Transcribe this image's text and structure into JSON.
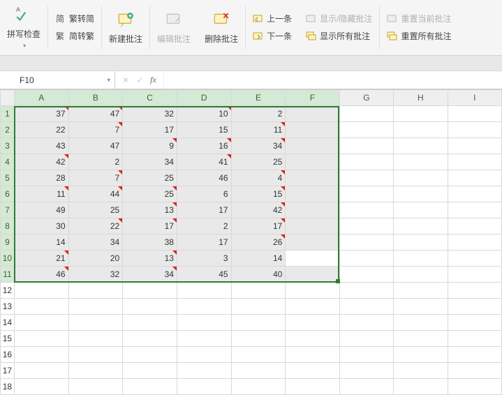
{
  "ribbon": {
    "spellcheck_label": "拼写检查",
    "trad_to_simp": "繁转简",
    "simp_to_trad": "简转繁",
    "new_comment": "新建批注",
    "edit_comment": "编辑批注",
    "delete_comment": "删除批注",
    "prev_comment": "上一条",
    "next_comment": "下一条",
    "show_hide_comment": "显示/隐藏批注",
    "show_all_comments": "显示所有批注",
    "reset_current": "重置当前批注",
    "reset_all": "重置所有批注"
  },
  "namebox": {
    "value": "F10"
  },
  "columns": [
    "A",
    "B",
    "C",
    "D",
    "E",
    "F",
    "G",
    "H",
    "I"
  ],
  "sel_cols": [
    "A",
    "B",
    "C",
    "D",
    "E",
    "F"
  ],
  "sel_rows": [
    1,
    2,
    3,
    4,
    5,
    6,
    7,
    8,
    9,
    10,
    11
  ],
  "active_cell": {
    "row": 10,
    "col": "F"
  },
  "row_count": 18,
  "chart_data": {
    "type": "table",
    "columns": [
      "A",
      "B",
      "C",
      "D",
      "E",
      "F"
    ],
    "rows": [
      {
        "A": 37,
        "B": 47,
        "C": 32,
        "D": 10,
        "E": 2,
        "F": null
      },
      {
        "A": 22,
        "B": 7,
        "C": 17,
        "D": 15,
        "E": 11,
        "F": null
      },
      {
        "A": 43,
        "B": 47,
        "C": 9,
        "D": 16,
        "E": 34,
        "F": null
      },
      {
        "A": 42,
        "B": 2,
        "C": 34,
        "D": 41,
        "E": 25,
        "F": null
      },
      {
        "A": 28,
        "B": 7,
        "C": 25,
        "D": 46,
        "E": 4,
        "F": null
      },
      {
        "A": 11,
        "B": 44,
        "C": 25,
        "D": 6,
        "E": 15,
        "F": null
      },
      {
        "A": 49,
        "B": 25,
        "C": 13,
        "D": 17,
        "E": 42,
        "F": null
      },
      {
        "A": 30,
        "B": 22,
        "C": 17,
        "D": 2,
        "E": 17,
        "F": null
      },
      {
        "A": 14,
        "B": 34,
        "C": 38,
        "D": 17,
        "E": 26,
        "F": null
      },
      {
        "A": 21,
        "B": 20,
        "C": 13,
        "D": 3,
        "E": 14,
        "F": null
      },
      {
        "A": 46,
        "B": 32,
        "C": 34,
        "D": 45,
        "E": 40,
        "F": null
      }
    ]
  },
  "comments_at": [
    [
      1,
      "A"
    ],
    [
      1,
      "B"
    ],
    [
      1,
      "D"
    ],
    [
      2,
      "B"
    ],
    [
      2,
      "E"
    ],
    [
      3,
      "C"
    ],
    [
      3,
      "D"
    ],
    [
      3,
      "E"
    ],
    [
      4,
      "A"
    ],
    [
      4,
      "D"
    ],
    [
      5,
      "B"
    ],
    [
      5,
      "E"
    ],
    [
      6,
      "A"
    ],
    [
      6,
      "B"
    ],
    [
      6,
      "C"
    ],
    [
      6,
      "E"
    ],
    [
      7,
      "C"
    ],
    [
      7,
      "E"
    ],
    [
      8,
      "B"
    ],
    [
      8,
      "C"
    ],
    [
      8,
      "E"
    ],
    [
      9,
      "E"
    ],
    [
      10,
      "A"
    ],
    [
      10,
      "C"
    ],
    [
      11,
      "A"
    ],
    [
      11,
      "C"
    ]
  ]
}
